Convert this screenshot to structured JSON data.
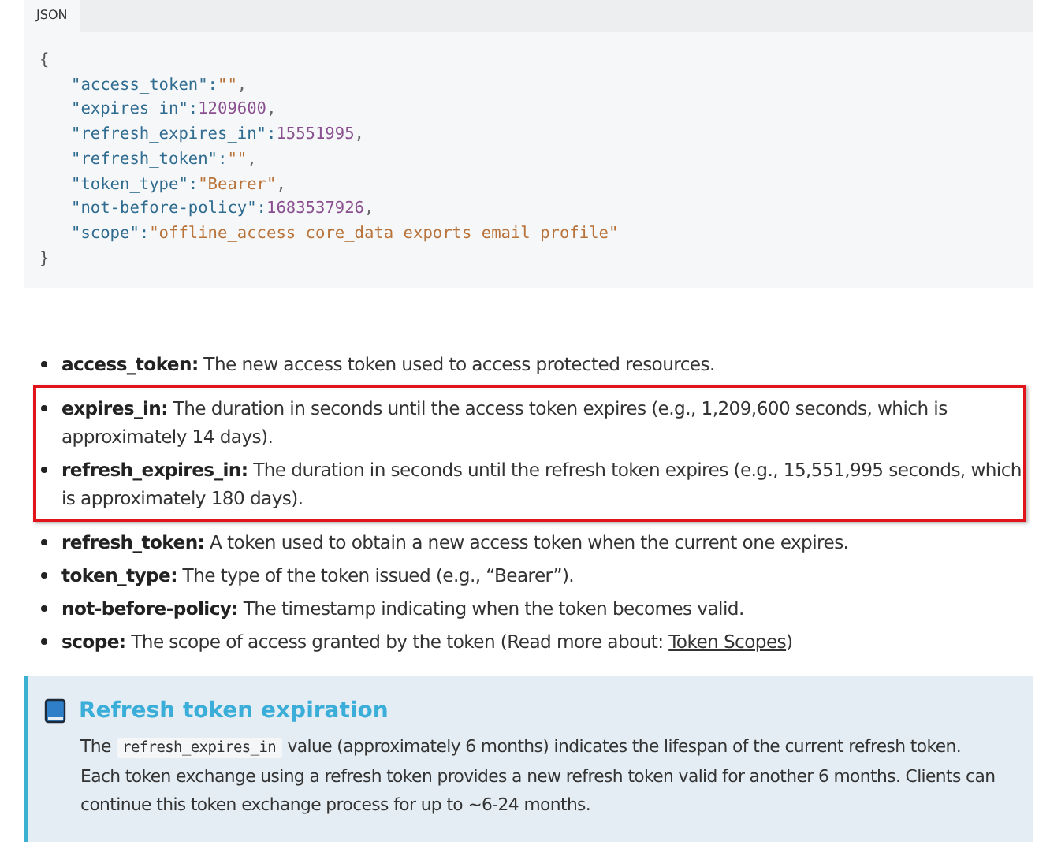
{
  "code_block": {
    "tab": "JSON",
    "lines": [
      {
        "kind": "punct",
        "text": "{"
      },
      {
        "kind": "string",
        "key": "\"access_token\":",
        "value": "\"\"",
        "tail": ","
      },
      {
        "kind": "number",
        "key": "\"expires_in\":",
        "value": "1209600",
        "tail": ","
      },
      {
        "kind": "number",
        "key": "\"refresh_expires_in\":",
        "value": "15551995",
        "tail": ","
      },
      {
        "kind": "string",
        "key": "\"refresh_token\":",
        "value": "\"\"",
        "tail": ","
      },
      {
        "kind": "string",
        "key": "\"token_type\":",
        "value": "\"Bearer\"",
        "tail": ","
      },
      {
        "kind": "number",
        "key": "\"not-before-policy\":",
        "value": "1683537926",
        "tail": ","
      },
      {
        "kind": "string",
        "key": "\"scope\":",
        "value": "\"offline_access core_data exports email profile\""
      },
      {
        "kind": "punct",
        "text": "}"
      }
    ]
  },
  "fields": [
    {
      "term": "access_token:",
      "text": "The new access token used to access protected resources.",
      "highlighted": false
    },
    {
      "term": "expires_in:",
      "text": "The duration in seconds until the access token expires (e.g., 1,209,600 seconds, which is approximately 14 days).",
      "highlighted": true
    },
    {
      "term": "refresh_expires_in:",
      "text": "The duration in seconds until the refresh token expires (e.g., 15,551,995 seconds, which is approximately 180 days).",
      "highlighted": true
    },
    {
      "term": "refresh_token:",
      "text": "A token used to obtain a new access token when the current one expires.",
      "highlighted": false
    },
    {
      "term": "token_type:",
      "text": "The type of the token issued (e.g., “Bearer”).",
      "highlighted": false
    },
    {
      "term": "not-before-policy:",
      "text": "The timestamp indicating when the token becomes valid.",
      "highlighted": false
    },
    {
      "term": "scope:",
      "text": "The scope of access granted by the token (Read more about: ",
      "link": "Token Scopes",
      "after": ")",
      "highlighted": false
    }
  ],
  "callout": {
    "title": "Refresh token expiration",
    "body": [
      {
        "kind": "text",
        "text": "The "
      },
      {
        "kind": "code",
        "text": "refresh_expires_in"
      },
      {
        "kind": "text",
        "text": " value (approximately 6 months) indicates the lifespan of the current refresh token. Each token exchange using a refresh token provides a new refresh token valid for another 6 months. Clients can continue this token exchange process for up to ~6-24 months."
      }
    ]
  }
}
